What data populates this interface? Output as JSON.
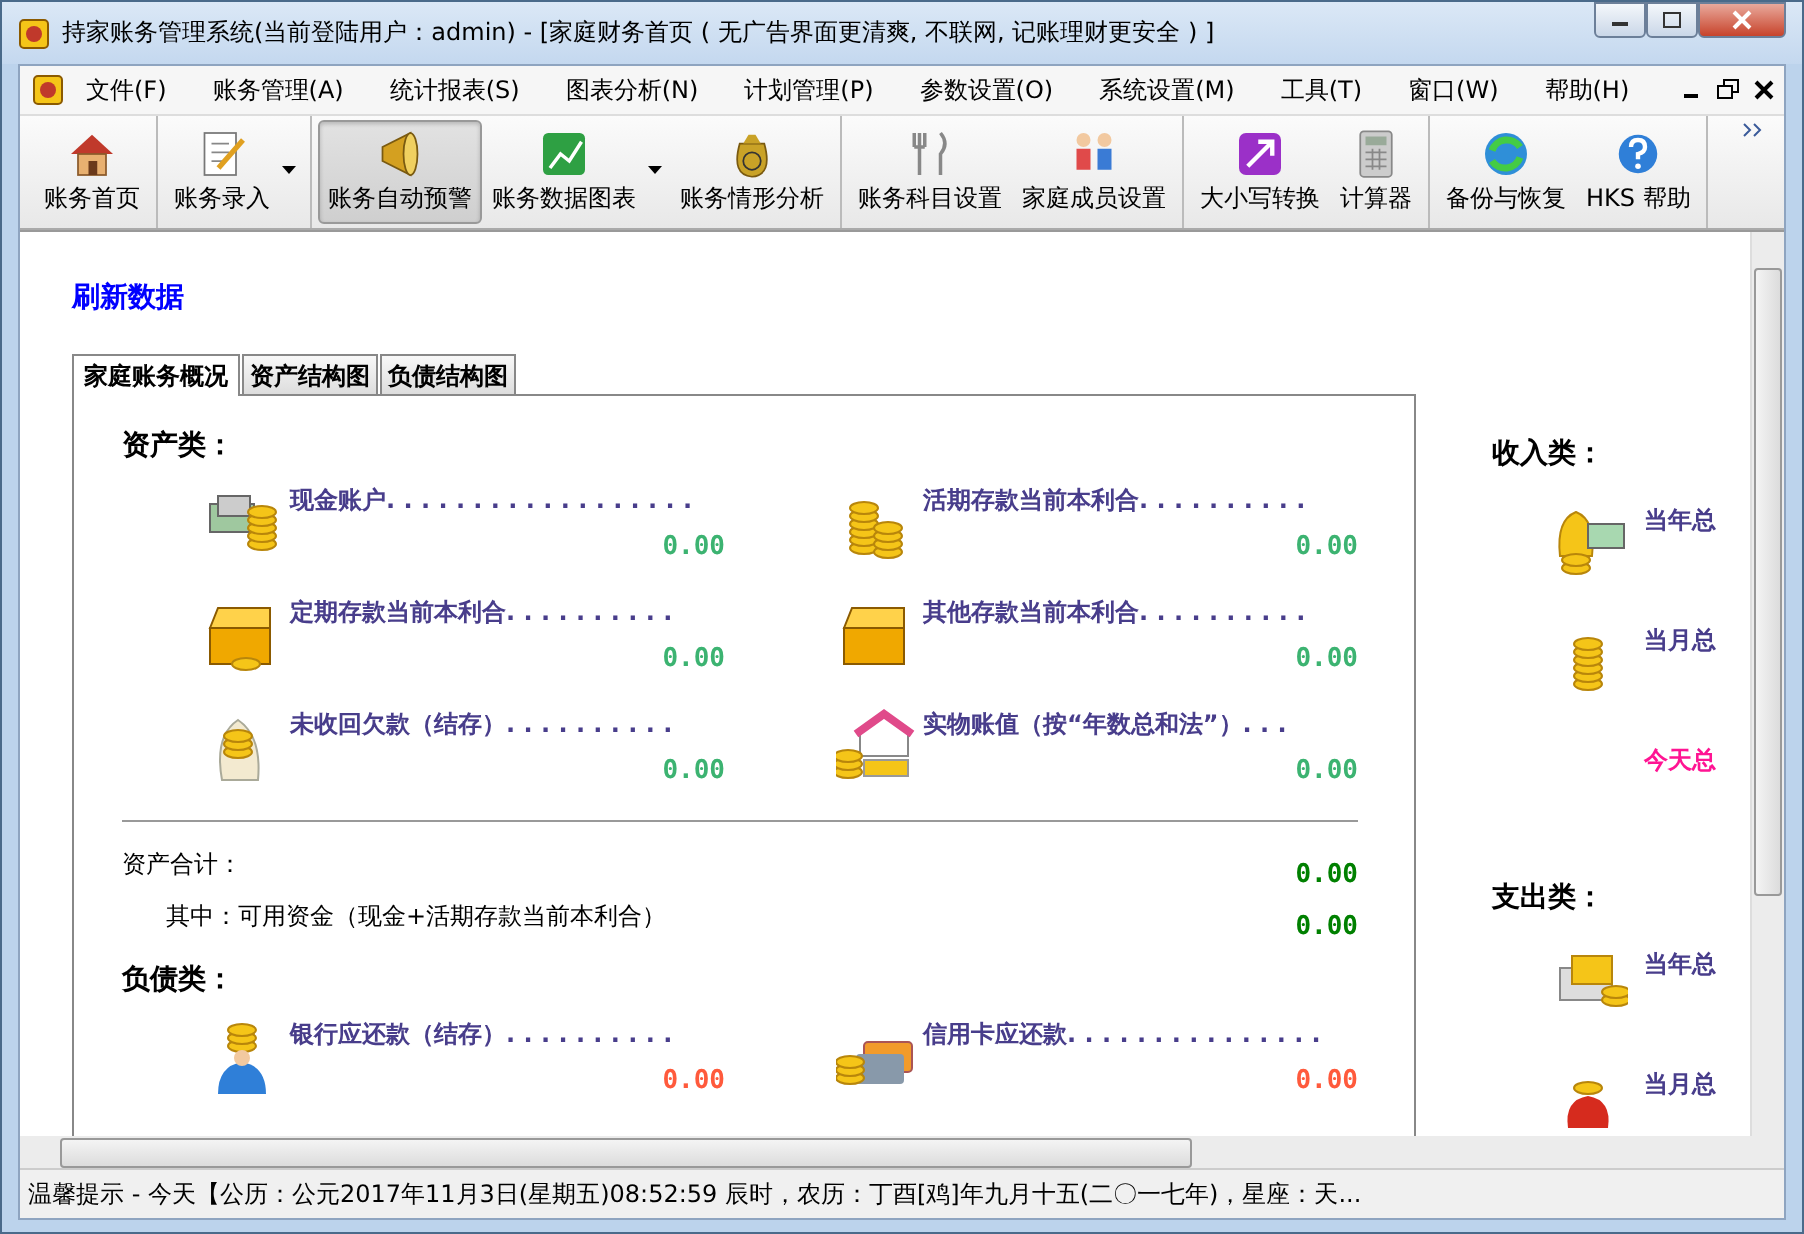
{
  "window": {
    "title": "持家账务管理系统(当前登陆用户：admin) - [家庭财务首页 ( 无广告界面更清爽, 不联网, 记账理财更安全 ) ]"
  },
  "menu": [
    "文件(F)",
    "账务管理(A)",
    "统计报表(S)",
    "图表分析(N)",
    "计划管理(P)",
    "参数设置(O)",
    "系统设置(M)",
    "工具(T)",
    "窗口(W)",
    "帮助(H)"
  ],
  "toolbar": [
    [
      {
        "label": "账务首页",
        "dropdown": false,
        "selected": false
      }
    ],
    [
      {
        "label": "账务录入",
        "dropdown": true,
        "selected": false
      }
    ],
    [
      {
        "label": "账务自动预警",
        "dropdown": false,
        "selected": true
      },
      {
        "label": "账务数据图表",
        "dropdown": true,
        "selected": false
      },
      {
        "label": "账务情形分析",
        "dropdown": false,
        "selected": false
      }
    ],
    [
      {
        "label": "账务科目设置",
        "dropdown": false,
        "selected": false
      },
      {
        "label": "家庭成员设置",
        "dropdown": false,
        "selected": false
      }
    ],
    [
      {
        "label": "大小写转换",
        "dropdown": false,
        "selected": false
      },
      {
        "label": "计算器",
        "dropdown": false,
        "selected": false
      }
    ],
    [
      {
        "label": "备份与恢复",
        "dropdown": false,
        "selected": false
      },
      {
        "label": "HKS 帮助",
        "dropdown": false,
        "selected": false
      }
    ]
  ],
  "refresh_link": "刷新数据",
  "tabs": [
    {
      "label": "家庭账务概况",
      "selected": true
    },
    {
      "label": "资产结构图",
      "selected": false
    },
    {
      "label": "负债结构图",
      "selected": false
    }
  ],
  "assets": {
    "title": "资产类：",
    "color": "#3cb371",
    "items": [
      {
        "label": "现金账户. . . . . . . . . . . . . . . . . .",
        "amount": "0.00"
      },
      {
        "label": "活期存款当前本利合. . . . . . . . . .",
        "amount": "0.00"
      },
      {
        "label": "定期存款当前本利合. . . . . . . . . .",
        "amount": "0.00"
      },
      {
        "label": "其他存款当前本利合. . . . . . . . . .",
        "amount": "0.00"
      },
      {
        "label": "未收回欠款（结存）. . . . . . . . . .",
        "amount": "0.00"
      },
      {
        "label": "实物账值（按“年数总和法”）. . .",
        "amount": "0.00"
      }
    ]
  },
  "totals": {
    "color": "#008000",
    "rows": [
      {
        "label": "资产合计：",
        "amount": "0.00"
      },
      {
        "label": "其中：可用资金（现金+活期存款当前本利合）",
        "amount": "0.00"
      }
    ]
  },
  "liabilities": {
    "title": "负债类：",
    "color": "#ff5a3c",
    "items": [
      {
        "label": "银行应还款（结存）. . . . . . . . . .",
        "amount": "0.00"
      },
      {
        "label": "信用卡应还款. . . . . . . . . . . . . . .",
        "amount": "0.00"
      }
    ]
  },
  "income": {
    "title": "收入类：",
    "items": [
      {
        "label": "当年总",
        "color": "#483d8b"
      },
      {
        "label": "当月总",
        "color": "#483d8b"
      },
      {
        "label": "今天总",
        "color": "#ff1493"
      }
    ]
  },
  "expense": {
    "title": "支出类：",
    "items": [
      {
        "label": "当年总",
        "color": "#483d8b"
      },
      {
        "label": "当月总",
        "color": "#483d8b"
      }
    ]
  },
  "status_bar": "温馨提示 - 今天【公历：公元2017年11月3日(星期五)08:52:59 辰时，农历：丁酉[鸡]年九月十五(二〇一七年)，星座：天..."
}
